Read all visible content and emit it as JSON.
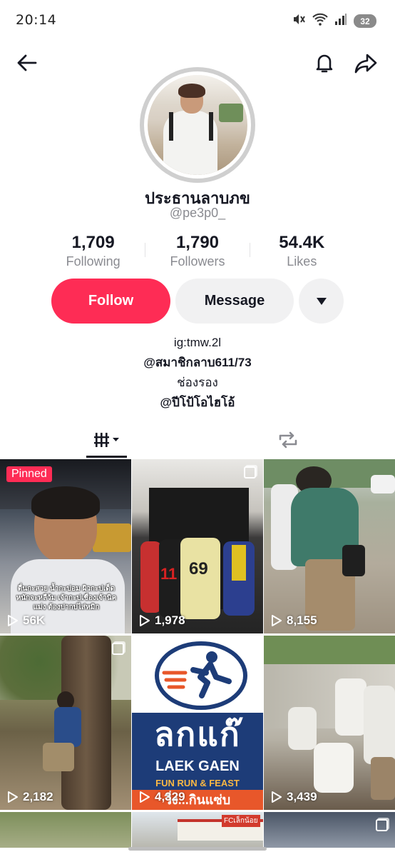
{
  "status_bar": {
    "time": "20:14",
    "battery": "32",
    "icons": [
      "mute-icon",
      "wifi-icon",
      "signal-icon",
      "battery-icon"
    ]
  },
  "profile": {
    "display_name": "ประธานลาบภข",
    "handle": "@pe3p0_",
    "stats": [
      {
        "value": "1,709",
        "label": "Following"
      },
      {
        "value": "1,790",
        "label": "Followers"
      },
      {
        "value": "54.4K",
        "label": "Likes"
      }
    ],
    "follow_label": "Follow",
    "message_label": "Message",
    "bio": [
      "ig:tmw.2l",
      "@สมาชิกลาบ611/73",
      "ช่องรอง",
      "@ปีโป้โอไฮโอ้"
    ]
  },
  "tabs": {
    "items": [
      "videos-grid-icon",
      "reposts-icon"
    ]
  },
  "videos": [
    {
      "views": "56K",
      "pinned": "Pinned",
      "caption": "ตื่นกะสวย น้ำกะบ่อม ผิวกะบ่เด็ด หนักจะหลืว้ม เจ้ากะบ่เชื่องเจ้านิคแม่ง ต้องปากบ่ไส่หมิก"
    },
    {
      "views": "1,978"
    },
    {
      "views": "8,155"
    },
    {
      "views": "2,182"
    },
    {
      "views": "4,329",
      "poster_text": "LAEK GAEN",
      "poster_sub": "FUN RUN & FEAST",
      "poster_thai": "วิ่ง...กินแซ่บ"
    },
    {
      "views": "3,439"
    }
  ],
  "colors": {
    "accent": "#fe2c55",
    "text_primary": "#161823",
    "text_secondary": "#8a8b91",
    "button_secondary": "#f1f1f2"
  }
}
